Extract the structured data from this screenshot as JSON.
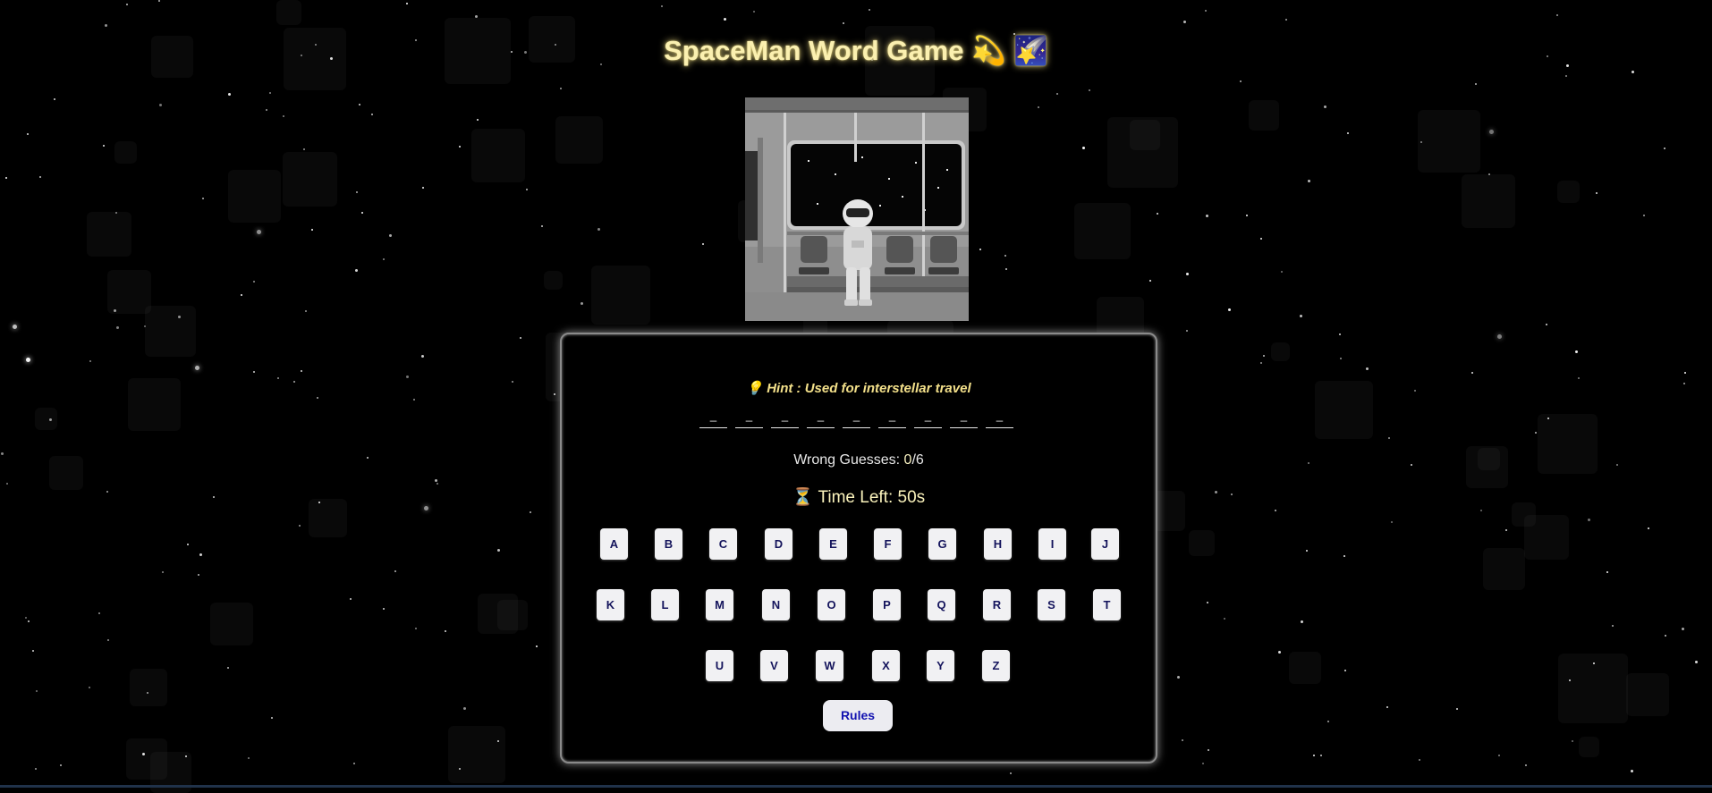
{
  "title": "SpaceMan Word Game",
  "title_emojis": "💫 🌠",
  "hint": {
    "icon": "💡",
    "text": "Hint : Used for interstellar travel"
  },
  "word_slots": [
    "_",
    "_",
    "_",
    "_",
    "_",
    "_",
    "_",
    "_",
    "_"
  ],
  "wrong_guesses": {
    "label": "Wrong Guesses: ",
    "count": "0",
    "max": "/6"
  },
  "timer": {
    "icon": "⏳",
    "text": "Time Left: 50s"
  },
  "keyboard": {
    "row1": [
      "A",
      "B",
      "C",
      "D",
      "E",
      "F",
      "G",
      "H",
      "I",
      "J"
    ],
    "row2": [
      "K",
      "L",
      "M",
      "N",
      "O",
      "P",
      "Q",
      "R",
      "S",
      "T"
    ],
    "row3": [
      "U",
      "V",
      "W",
      "X",
      "Y",
      "Z"
    ]
  },
  "rules_label": "Rules",
  "colors": {
    "background": "#000000",
    "title": "#fbf0b0",
    "hint": "#f3e08a",
    "key_text": "#14145c",
    "rules_text": "#1212b0"
  }
}
